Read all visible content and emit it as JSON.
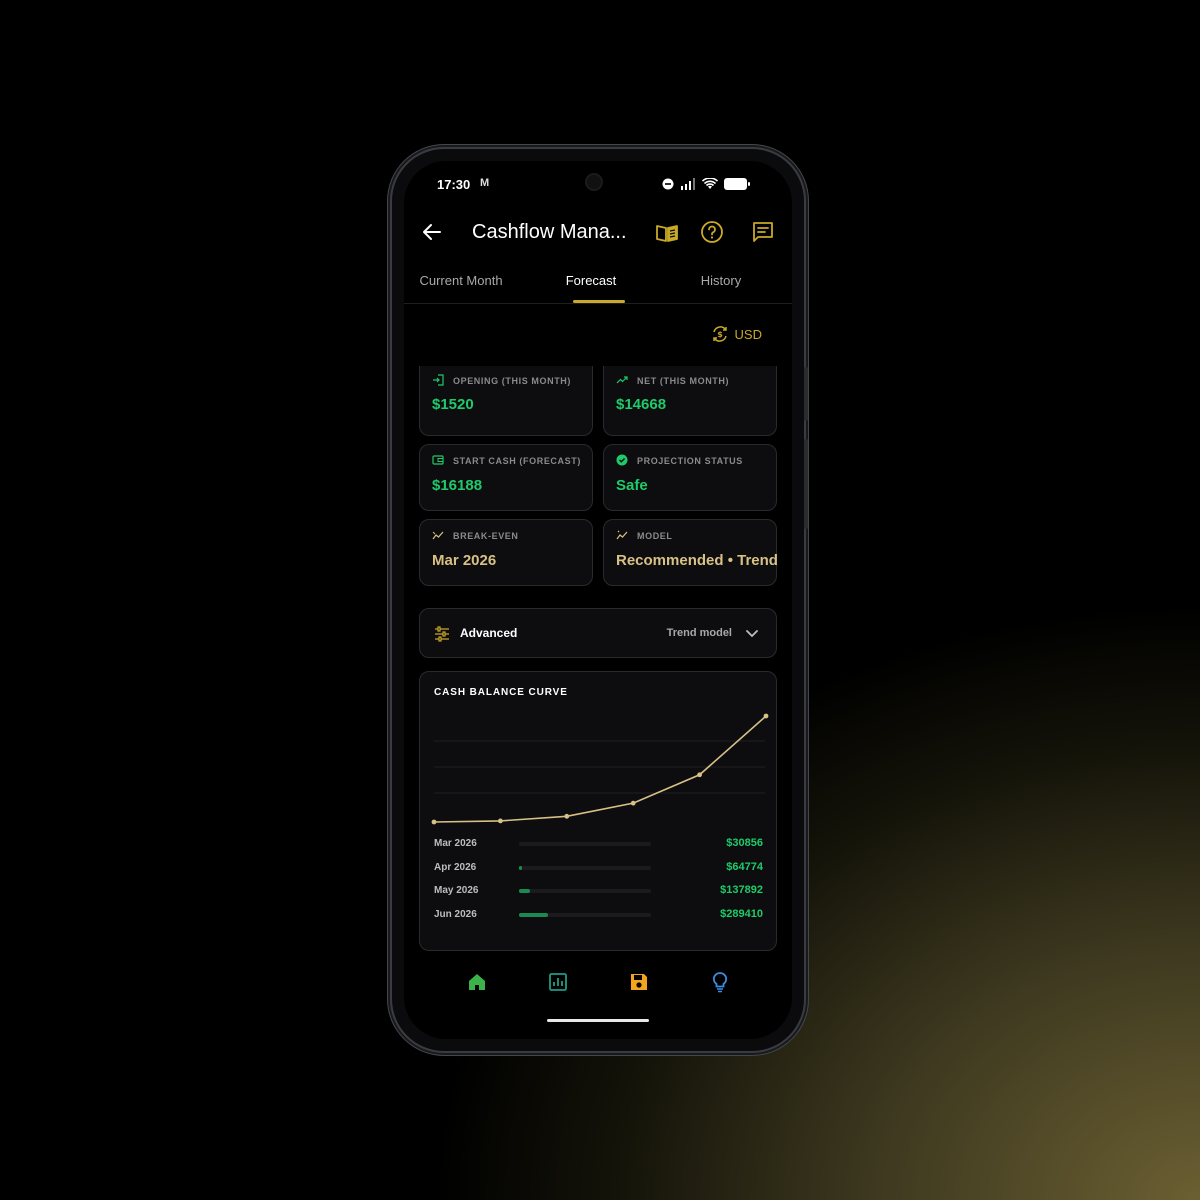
{
  "status_bar": {
    "time": "17:30",
    "notification": "M"
  },
  "app_bar": {
    "title": "Cashflow Mana..."
  },
  "tabs": [
    {
      "label": "Current Month",
      "active": false
    },
    {
      "label": "Forecast",
      "active": true
    },
    {
      "label": "History",
      "active": false
    }
  ],
  "currency": {
    "label": "USD"
  },
  "cards": {
    "opening": {
      "label": "OPENING (THIS MONTH)",
      "value": "$1520"
    },
    "net": {
      "label": "NET (THIS MONTH)",
      "value": "$14668"
    },
    "start_cash": {
      "label": "START CASH (FORECAST)",
      "value": "$16188"
    },
    "projection": {
      "label": "PROJECTION STATUS",
      "value": "Safe"
    },
    "break_even": {
      "label": "BREAK-EVEN",
      "value": "Mar 2026"
    },
    "model": {
      "label": "MODEL",
      "value": "Recommended • Trend"
    }
  },
  "advanced": {
    "label": "Advanced",
    "selected_model": "Trend model"
  },
  "chart": {
    "title": "CASH BALANCE CURVE",
    "rows": [
      {
        "month": "Mar 2026",
        "value": "$30856",
        "fill": 0.0
      },
      {
        "month": "Apr 2026",
        "value": "$64774",
        "fill": 0.025
      },
      {
        "month": "May 2026",
        "value": "$137892",
        "fill": 0.085
      },
      {
        "month": "Jun 2026",
        "value": "$289410",
        "fill": 0.22
      }
    ]
  },
  "chart_data": {
    "type": "line",
    "title": "CASH BALANCE CURVE",
    "series": [
      {
        "values": [
          16188,
          19000,
          30856,
          64774,
          137892,
          289410
        ]
      }
    ],
    "grid": true
  },
  "colors": {
    "accent": "#c9a927",
    "positive": "#1fca6a",
    "highlight": "#d8c185",
    "nav_home": "#3bb34a",
    "nav_reports": "#1e9c86",
    "nav_save": "#f4a31c",
    "nav_ideas": "#3a8ee6"
  },
  "icons": {
    "back": "arrow-left-icon",
    "book": "book-open-icon",
    "help": "help-circle-icon",
    "feedback": "message-icon",
    "currency": "currency-exchange-icon",
    "advanced": "sliders-icon",
    "expand": "chevron-down-icon",
    "nav": [
      "home-icon",
      "chart-icon",
      "save-icon",
      "lightbulb-icon"
    ]
  }
}
